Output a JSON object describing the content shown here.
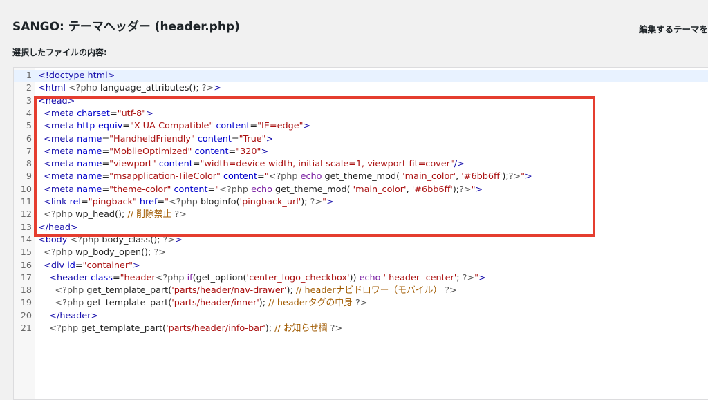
{
  "header": {
    "title": "SANGO: テーマヘッダー (header.php)",
    "theme_select_label": "編集するテーマを",
    "file_label": "選択したファイルの内容:"
  },
  "editor": {
    "lines": [
      {
        "n": "1",
        "tokens": [
          [
            "tag",
            "<!doctype html>"
          ]
        ]
      },
      {
        "n": "2",
        "tokens": [
          [
            "tag",
            "<html "
          ],
          [
            "php",
            "<?php "
          ],
          [
            "plain",
            "language_attributes(); "
          ],
          [
            "php",
            "?>"
          ],
          [
            "tag",
            ">"
          ]
        ]
      },
      {
        "n": "3",
        "tokens": [
          [
            "tag",
            "<head>"
          ]
        ]
      },
      {
        "n": "4",
        "tokens": [
          [
            "plain",
            "  "
          ],
          [
            "tag",
            "<meta "
          ],
          [
            "attr",
            "charset"
          ],
          [
            "plain",
            "="
          ],
          [
            "str",
            "\"utf-8\""
          ],
          [
            "tag",
            ">"
          ]
        ]
      },
      {
        "n": "5",
        "tokens": [
          [
            "plain",
            "  "
          ],
          [
            "tag",
            "<meta "
          ],
          [
            "attr",
            "http-equiv"
          ],
          [
            "plain",
            "="
          ],
          [
            "str",
            "\"X-UA-Compatible\""
          ],
          [
            "plain",
            " "
          ],
          [
            "attr",
            "content"
          ],
          [
            "plain",
            "="
          ],
          [
            "str",
            "\"IE=edge\""
          ],
          [
            "tag",
            ">"
          ]
        ]
      },
      {
        "n": "6",
        "tokens": [
          [
            "plain",
            "  "
          ],
          [
            "tag",
            "<meta "
          ],
          [
            "attr",
            "name"
          ],
          [
            "plain",
            "="
          ],
          [
            "str",
            "\"HandheldFriendly\""
          ],
          [
            "plain",
            " "
          ],
          [
            "attr",
            "content"
          ],
          [
            "plain",
            "="
          ],
          [
            "str",
            "\"True\""
          ],
          [
            "tag",
            ">"
          ]
        ]
      },
      {
        "n": "7",
        "tokens": [
          [
            "plain",
            "  "
          ],
          [
            "tag",
            "<meta "
          ],
          [
            "attr",
            "name"
          ],
          [
            "plain",
            "="
          ],
          [
            "str",
            "\"MobileOptimized\""
          ],
          [
            "plain",
            " "
          ],
          [
            "attr",
            "content"
          ],
          [
            "plain",
            "="
          ],
          [
            "str",
            "\"320\""
          ],
          [
            "tag",
            ">"
          ]
        ]
      },
      {
        "n": "8",
        "tokens": [
          [
            "plain",
            "  "
          ],
          [
            "tag",
            "<meta "
          ],
          [
            "attr",
            "name"
          ],
          [
            "plain",
            "="
          ],
          [
            "str",
            "\"viewport\""
          ],
          [
            "plain",
            " "
          ],
          [
            "attr",
            "content"
          ],
          [
            "plain",
            "="
          ],
          [
            "str",
            "\"width=device-width, initial-scale=1, viewport-fit=cover\""
          ],
          [
            "tag",
            "/>"
          ]
        ]
      },
      {
        "n": "9",
        "tokens": [
          [
            "plain",
            "  "
          ],
          [
            "tag",
            "<meta "
          ],
          [
            "attr",
            "name"
          ],
          [
            "plain",
            "="
          ],
          [
            "str",
            "\"msapplication-TileColor\""
          ],
          [
            "plain",
            " "
          ],
          [
            "attr",
            "content"
          ],
          [
            "plain",
            "="
          ],
          [
            "str",
            "\""
          ],
          [
            "php",
            "<?php "
          ],
          [
            "kw",
            "echo "
          ],
          [
            "plain",
            "get_theme_mod( "
          ],
          [
            "str",
            "'main_color'"
          ],
          [
            "plain",
            ", "
          ],
          [
            "str",
            "'#6bb6ff'"
          ],
          [
            "plain",
            ");"
          ],
          [
            "php",
            "?>"
          ],
          [
            "str",
            "\""
          ],
          [
            "tag",
            ">"
          ]
        ]
      },
      {
        "n": "10",
        "tokens": [
          [
            "plain",
            "  "
          ],
          [
            "tag",
            "<meta "
          ],
          [
            "attr",
            "name"
          ],
          [
            "plain",
            "="
          ],
          [
            "str",
            "\"theme-color\""
          ],
          [
            "plain",
            " "
          ],
          [
            "attr",
            "content"
          ],
          [
            "plain",
            "="
          ],
          [
            "str",
            "\""
          ],
          [
            "php",
            "<?php "
          ],
          [
            "kw",
            "echo "
          ],
          [
            "plain",
            "get_theme_mod( "
          ],
          [
            "str",
            "'main_color'"
          ],
          [
            "plain",
            ", "
          ],
          [
            "str",
            "'#6bb6ff'"
          ],
          [
            "plain",
            ");"
          ],
          [
            "php",
            "?>"
          ],
          [
            "str",
            "\""
          ],
          [
            "tag",
            ">"
          ]
        ]
      },
      {
        "n": "11",
        "tokens": [
          [
            "plain",
            "  "
          ],
          [
            "tag",
            "<link "
          ],
          [
            "attr",
            "rel"
          ],
          [
            "plain",
            "="
          ],
          [
            "str",
            "\"pingback\""
          ],
          [
            "plain",
            " "
          ],
          [
            "attr",
            "href"
          ],
          [
            "plain",
            "="
          ],
          [
            "str",
            "\""
          ],
          [
            "php",
            "<?php "
          ],
          [
            "plain",
            "bloginfo("
          ],
          [
            "str",
            "'pingback_url'"
          ],
          [
            "plain",
            "); "
          ],
          [
            "php",
            "?>"
          ],
          [
            "str",
            "\""
          ],
          [
            "tag",
            ">"
          ]
        ]
      },
      {
        "n": "12",
        "tokens": [
          [
            "plain",
            "  "
          ],
          [
            "php",
            "<?php "
          ],
          [
            "plain",
            "wp_head(); "
          ],
          [
            "cmt",
            "// 削除禁止 "
          ],
          [
            "php",
            "?>"
          ]
        ]
      },
      {
        "n": "13",
        "tokens": [
          [
            "tag",
            "</head>"
          ]
        ]
      },
      {
        "n": "14",
        "tokens": [
          [
            "tag",
            "<body "
          ],
          [
            "php",
            "<?php "
          ],
          [
            "plain",
            "body_class(); "
          ],
          [
            "php",
            "?>"
          ],
          [
            "tag",
            ">"
          ]
        ]
      },
      {
        "n": "15",
        "tokens": [
          [
            "plain",
            "  "
          ],
          [
            "php",
            "<?php "
          ],
          [
            "plain",
            "wp_body_open(); "
          ],
          [
            "php",
            "?>"
          ]
        ]
      },
      {
        "n": "16",
        "tokens": [
          [
            "plain",
            "  "
          ],
          [
            "tag",
            "<div "
          ],
          [
            "attr",
            "id"
          ],
          [
            "plain",
            "="
          ],
          [
            "str",
            "\"container\""
          ],
          [
            "tag",
            ">"
          ]
        ]
      },
      {
        "n": "17",
        "tokens": [
          [
            "plain",
            "    "
          ],
          [
            "tag",
            "<header "
          ],
          [
            "attr",
            "class"
          ],
          [
            "plain",
            "="
          ],
          [
            "str",
            "\"header"
          ],
          [
            "php",
            "<?php "
          ],
          [
            "kw",
            "if"
          ],
          [
            "plain",
            "(get_option("
          ],
          [
            "str",
            "'center_logo_checkbox'"
          ],
          [
            "plain",
            ")) "
          ],
          [
            "kw",
            "echo "
          ],
          [
            "str",
            "' header--center'"
          ],
          [
            "plain",
            "; "
          ],
          [
            "php",
            "?>"
          ],
          [
            "str",
            "\""
          ],
          [
            "tag",
            ">"
          ]
        ]
      },
      {
        "n": "18",
        "tokens": [
          [
            "plain",
            "      "
          ],
          [
            "php",
            "<?php "
          ],
          [
            "plain",
            "get_template_part("
          ],
          [
            "str",
            "'parts/header/nav-drawer'"
          ],
          [
            "plain",
            "); "
          ],
          [
            "cmt",
            "// headerナビドロワー（モバイル） "
          ],
          [
            "php",
            "?>"
          ]
        ]
      },
      {
        "n": "19",
        "tokens": [
          [
            "plain",
            "      "
          ],
          [
            "php",
            "<?php "
          ],
          [
            "plain",
            "get_template_part("
          ],
          [
            "str",
            "'parts/header/inner'"
          ],
          [
            "plain",
            "); "
          ],
          [
            "cmt",
            "// headerタグの中身 "
          ],
          [
            "php",
            "?>"
          ]
        ]
      },
      {
        "n": "20",
        "tokens": [
          [
            "plain",
            "    "
          ],
          [
            "tag",
            "</header>"
          ]
        ]
      },
      {
        "n": "21",
        "tokens": [
          [
            "plain",
            "    "
          ],
          [
            "php",
            "<?php "
          ],
          [
            "plain",
            "get_template_part("
          ],
          [
            "str",
            "'parts/header/info-bar'"
          ],
          [
            "plain",
            "); "
          ],
          [
            "cmt",
            "// お知らせ欄 "
          ],
          [
            "php",
            "?>"
          ]
        ]
      }
    ]
  }
}
